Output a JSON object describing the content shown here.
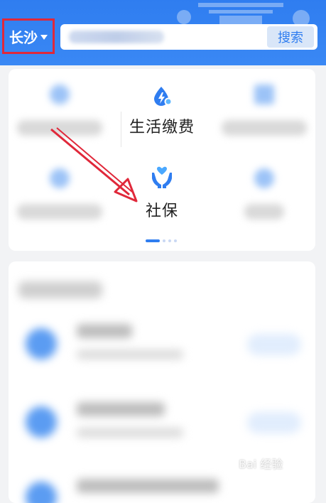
{
  "header": {
    "city": "长沙",
    "search_button": "搜索",
    "search_placeholder": ""
  },
  "services": {
    "items": [
      {
        "label": "生活缴费",
        "icon": "water-lightning-icon",
        "visible": true
      },
      {
        "label": "社保",
        "icon": "hands-heart-icon",
        "visible": true
      }
    ],
    "pagination": {
      "current": 1,
      "total": 4
    }
  },
  "colors": {
    "primary": "#2f7df0",
    "highlight_box": "#e0283a",
    "arrow": "#e0283a"
  },
  "watermark": "Bai 经验"
}
